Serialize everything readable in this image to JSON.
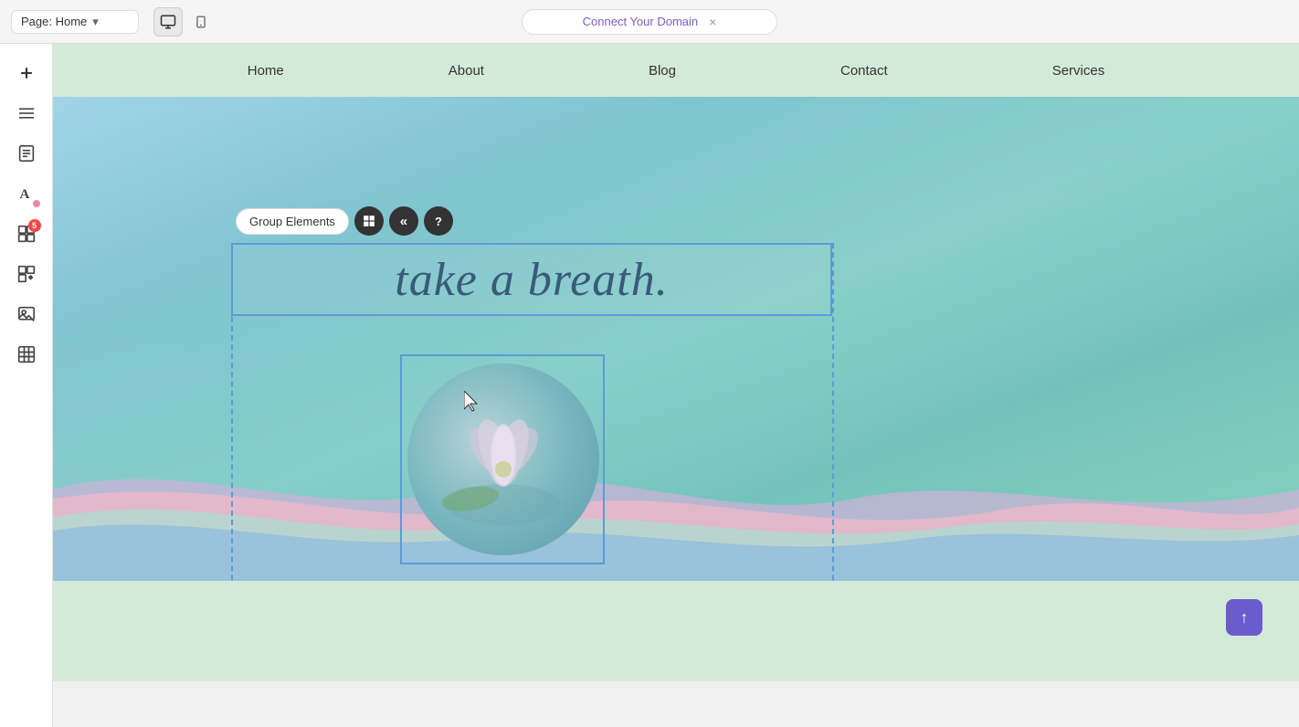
{
  "browser": {
    "page_label": "Page: Home",
    "chevron_icon": "▾",
    "address_bar_text": "Connect Your Domain",
    "tab_close": "×"
  },
  "devices": {
    "desktop_icon": "desktop",
    "mobile_icon": "mobile"
  },
  "sidebar": {
    "items": [
      {
        "id": "add",
        "icon": "＋",
        "label": "add-element"
      },
      {
        "id": "layers",
        "icon": "≡",
        "label": "layers"
      },
      {
        "id": "pages",
        "icon": "☰",
        "label": "pages"
      },
      {
        "id": "text-styles",
        "icon": "A",
        "label": "text-styles"
      },
      {
        "id": "apps",
        "icon": "⊞",
        "label": "apps",
        "badge": "5"
      },
      {
        "id": "widgets",
        "icon": "⊡",
        "label": "widgets"
      },
      {
        "id": "media",
        "icon": "▣",
        "label": "media"
      },
      {
        "id": "table",
        "icon": "⊟",
        "label": "table"
      }
    ]
  },
  "site_nav": {
    "items": [
      {
        "id": "home",
        "label": "Home"
      },
      {
        "id": "about",
        "label": "About"
      },
      {
        "id": "blog",
        "label": "Blog"
      },
      {
        "id": "contact",
        "label": "Contact"
      },
      {
        "id": "services",
        "label": "Services"
      }
    ]
  },
  "hero": {
    "headline": "take a breath.",
    "image_alt": "lotus flower"
  },
  "toolbar": {
    "group_btn_label": "Group Elements",
    "move_layers_icon": "⊞",
    "back_icon": "«",
    "help_icon": "?"
  },
  "scroll_btn": {
    "icon": "↑"
  },
  "colors": {
    "nav_bg": "#d4ead8",
    "hero_start": "#a8d8ea",
    "hero_end": "#6bc8c0",
    "selection_border": "#5b9bd5",
    "scroll_btn_bg": "#6b5bcd",
    "wave_pink": "#f0b8c8",
    "wave_mint": "#a8e0d0",
    "wave_blue": "#88b8e0",
    "wave_lavender": "#d0b0d8"
  }
}
